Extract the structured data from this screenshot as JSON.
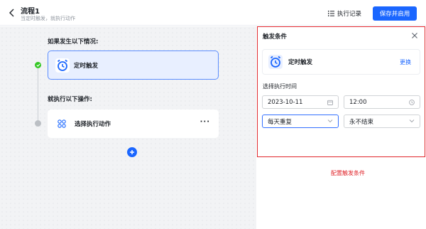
{
  "header": {
    "title": "流程1",
    "subtitle": "当定时触发，就执行动作",
    "log_label": "执行记录",
    "save_label": "保存并启用"
  },
  "canvas": {
    "if_label": "如果发生以下情况:",
    "trigger_label": "定时触发",
    "then_label": "就执行以下操作:",
    "action_label": "选择执行动作",
    "more_label": "···"
  },
  "panel": {
    "title": "触发条件",
    "trigger_type": "定时触发",
    "change_label": "更换",
    "time_section": "选择执行时间",
    "date_value": "2023-10-11",
    "time_value": "12:00",
    "repeat_value": "每天重复",
    "end_value": "永不结束"
  },
  "annotation": "配置触发条件",
  "colors": {
    "primary": "#1a66ff",
    "success": "#34c724",
    "highlight": "#e0262c"
  }
}
